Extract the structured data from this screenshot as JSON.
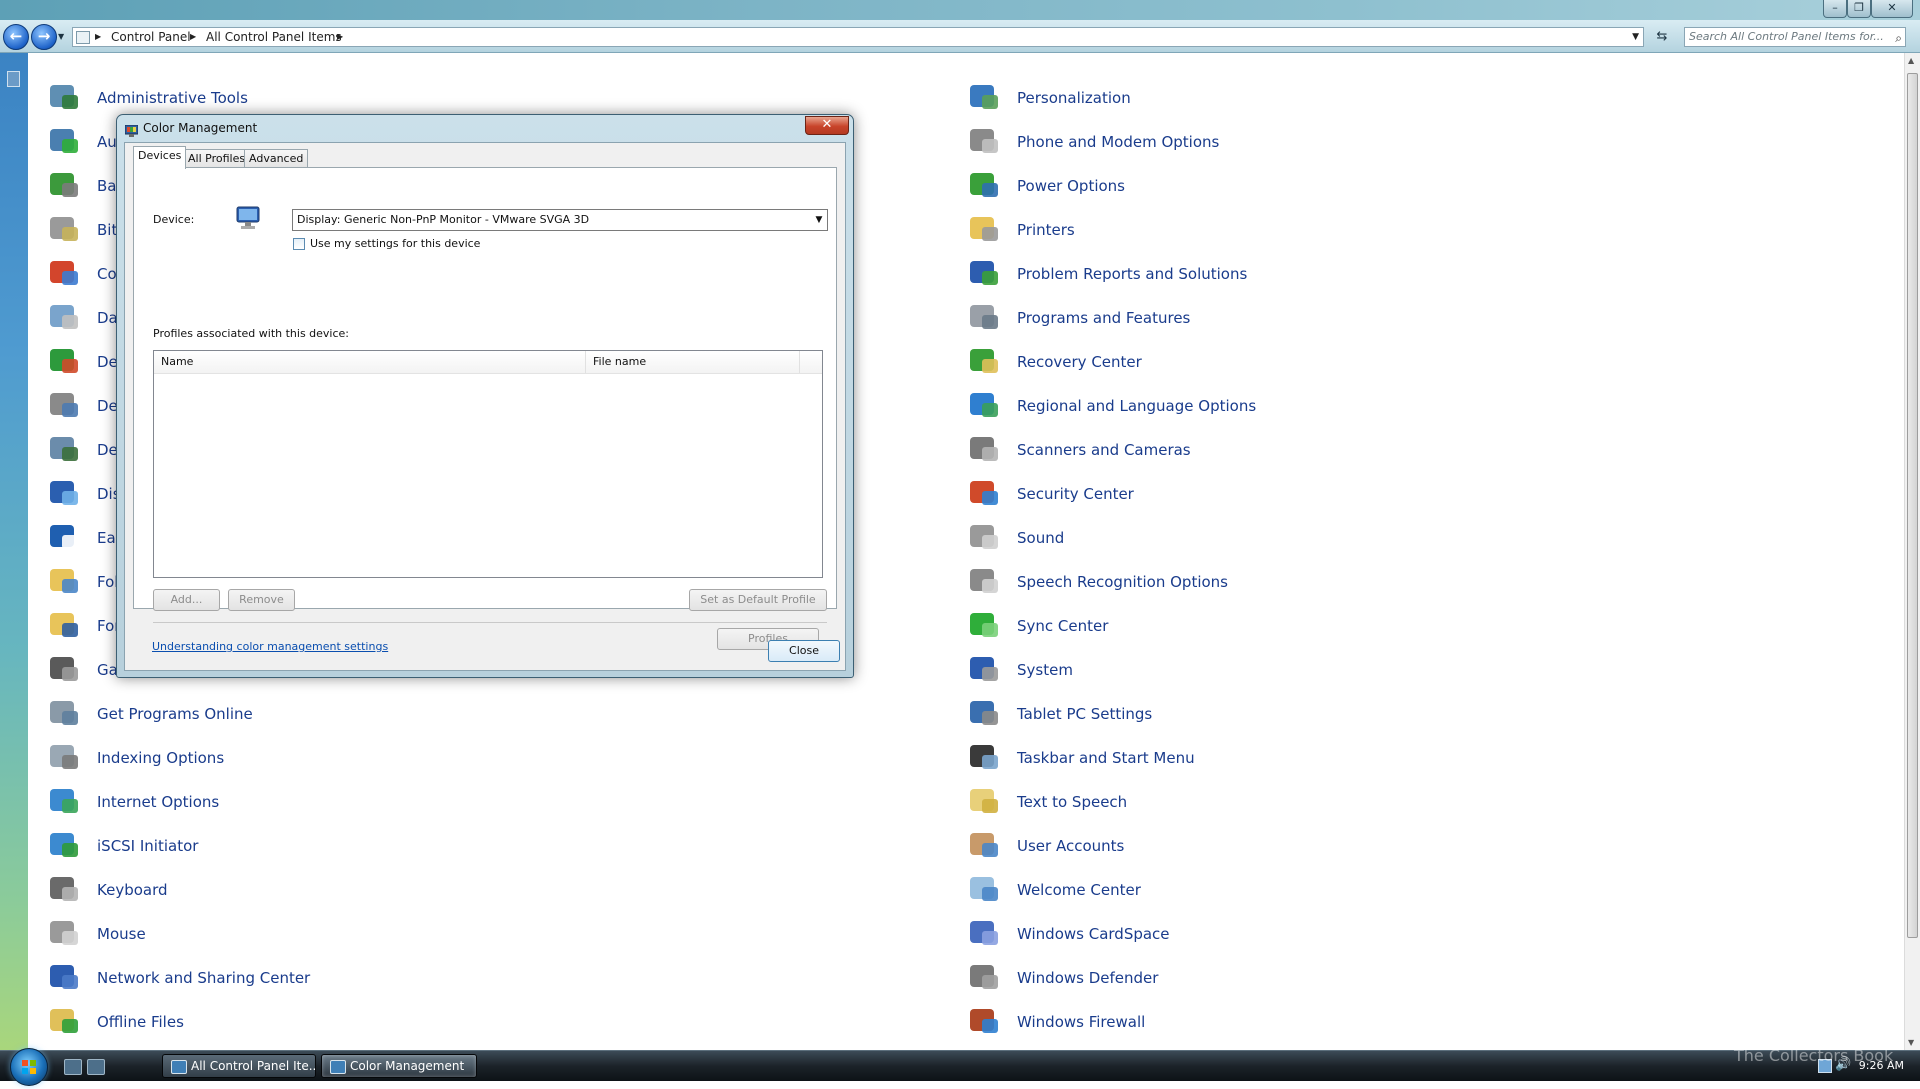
{
  "explorer": {
    "breadcrumb": [
      "Control Panel",
      "All Control Panel Items"
    ],
    "search_placeholder": "Search All Control Panel Items for...",
    "left_items": [
      {
        "label": "Administrative Tools",
        "icon": "administrative-tools-icon",
        "c1": "#5f8fb3",
        "c2": "#2f7a3a"
      },
      {
        "label": "AutoPlay",
        "icon": "autoplay-icon",
        "c1": "#4a7fb0",
        "c2": "#2fae3a"
      },
      {
        "label": "Backup and Restore Center",
        "icon": "backup-icon",
        "c1": "#3c9a3c",
        "c2": "#7b7b7b"
      },
      {
        "label": "BitLocker Drive Encryption",
        "icon": "bitlocker-icon",
        "c1": "#9a9a9a",
        "c2": "#c7b35a"
      },
      {
        "label": "Color Management",
        "icon": "color-management-icon",
        "c1": "#d3452c",
        "c2": "#3c7bd0"
      },
      {
        "label": "Date and Time",
        "icon": "date-time-icon",
        "c1": "#7aa4cc",
        "c2": "#c0c0c0"
      },
      {
        "label": "Default Programs",
        "icon": "default-programs-icon",
        "c1": "#2d9a3c",
        "c2": "#d04a2a"
      },
      {
        "label": "Device Manager",
        "icon": "device-icon",
        "c1": "#8a8a8a",
        "c2": "#4c7ab0"
      },
      {
        "label": "Device Manager",
        "icon": "device-manager-icon",
        "c1": "#6b8cab",
        "c2": "#3b6f3b"
      },
      {
        "label": "Display",
        "icon": "display-icon",
        "c1": "#2b5fb0",
        "c2": "#6fb0e8"
      },
      {
        "label": "Ease of Access Center",
        "icon": "ease-of-access-icon",
        "c1": "#1f5fb0",
        "c2": "#ffffff"
      },
      {
        "label": "Folder Options",
        "icon": "folder-options-icon",
        "c1": "#e8c45a",
        "c2": "#4a86c8"
      },
      {
        "label": "Fonts",
        "icon": "fonts-icon",
        "c1": "#e8c45a",
        "c2": "#2f5fa0"
      },
      {
        "label": "Game Controllers",
        "icon": "game-controllers-icon",
        "c1": "#5a5a5a",
        "c2": "#9a9a9a"
      },
      {
        "label": "Get Programs Online",
        "icon": "get-programs-icon",
        "c1": "#8a9aa8",
        "c2": "#5e7f9d"
      },
      {
        "label": "Indexing Options",
        "icon": "indexing-options-icon",
        "c1": "#9aa8b4",
        "c2": "#7a7a7a"
      },
      {
        "label": "Internet Options",
        "icon": "internet-options-icon",
        "c1": "#3c8ad0",
        "c2": "#3aa55a"
      },
      {
        "label": "iSCSI Initiator",
        "icon": "iscsi-initiator-icon",
        "c1": "#3c8ad0",
        "c2": "#2e9a3a"
      },
      {
        "label": "Keyboard",
        "icon": "keyboard-icon",
        "c1": "#6a6a6a",
        "c2": "#b4b4b4"
      },
      {
        "label": "Mouse",
        "icon": "mouse-icon",
        "c1": "#9a9a9a",
        "c2": "#d2d2d2"
      },
      {
        "label": "Network and Sharing Center",
        "icon": "network-sharing-icon",
        "c1": "#2d5db0",
        "c2": "#4a7ac8"
      },
      {
        "label": "Offline Files",
        "icon": "offline-files-icon",
        "c1": "#e0c05a",
        "c2": "#2fa03a"
      }
    ],
    "right_items": [
      {
        "label": "Personalization",
        "icon": "personalization-icon",
        "c1": "#3a7ac0",
        "c2": "#5aa05a"
      },
      {
        "label": "Phone and Modem Options",
        "icon": "phone-modem-icon",
        "c1": "#8a8a8a",
        "c2": "#c0c0c0"
      },
      {
        "label": "Power Options",
        "icon": "power-options-icon",
        "c1": "#3aa03a",
        "c2": "#2f6fb0"
      },
      {
        "label": "Printers",
        "icon": "printers-icon",
        "c1": "#e8c45a",
        "c2": "#9a9a9a"
      },
      {
        "label": "Problem Reports and Solutions",
        "icon": "problem-reports-icon",
        "c1": "#2d5db0",
        "c2": "#3aa03a"
      },
      {
        "label": "Programs and Features",
        "icon": "programs-features-icon",
        "c1": "#9aa0a8",
        "c2": "#6a7a88"
      },
      {
        "label": "Recovery Center",
        "icon": "recovery-center-icon",
        "c1": "#3aa03a",
        "c2": "#e0c05a"
      },
      {
        "label": "Regional and Language Options",
        "icon": "regional-language-icon",
        "c1": "#2f7fd0",
        "c2": "#3aa05a"
      },
      {
        "label": "Scanners and Cameras",
        "icon": "scanners-cameras-icon",
        "c1": "#7a7a7a",
        "c2": "#b4b4b4"
      },
      {
        "label": "Security Center",
        "icon": "security-center-icon",
        "c1": "#d04a2a",
        "c2": "#2f7fd0"
      },
      {
        "label": "Sound",
        "icon": "sound-icon",
        "c1": "#9a9a9a",
        "c2": "#cfcfcf"
      },
      {
        "label": "Speech Recognition Options",
        "icon": "speech-recognition-icon",
        "c1": "#8a8a8a",
        "c2": "#d0d0d0"
      },
      {
        "label": "Sync Center",
        "icon": "sync-center-icon",
        "c1": "#2fae3a",
        "c2": "#7ad07a"
      },
      {
        "label": "System",
        "icon": "system-icon",
        "c1": "#2d5db0",
        "c2": "#9a9a9a"
      },
      {
        "label": "Tablet PC Settings",
        "icon": "tablet-pc-icon",
        "c1": "#3a6fb0",
        "c2": "#8a8a8a"
      },
      {
        "label": "Taskbar and Start Menu",
        "icon": "taskbar-start-icon",
        "c1": "#3a3a3a",
        "c2": "#7aa4cc"
      },
      {
        "label": "Text to Speech",
        "icon": "text-to-speech-icon",
        "c1": "#e8d07a",
        "c2": "#d0b040"
      },
      {
        "label": "User Accounts",
        "icon": "user-accounts-icon",
        "c1": "#c89a6a",
        "c2": "#4a86c8"
      },
      {
        "label": "Welcome Center",
        "icon": "welcome-center-icon",
        "c1": "#9ac0e0",
        "c2": "#4a86c8"
      },
      {
        "label": "Windows CardSpace",
        "icon": "windows-cardspace-icon",
        "c1": "#4a6fc0",
        "c2": "#8aa0e0"
      },
      {
        "label": "Windows Defender",
        "icon": "windows-defender-icon",
        "c1": "#7a7a7a",
        "c2": "#a0a0a0"
      },
      {
        "label": "Windows Firewall",
        "icon": "windows-firewall-icon",
        "c1": "#b04a2a",
        "c2": "#2f7fd0"
      }
    ]
  },
  "dialog": {
    "title": "Color Management",
    "tabs": [
      "Devices",
      "All Profiles",
      "Advanced"
    ],
    "device_label": "Device:",
    "device_value": "Display: Generic Non-PnP Monitor - VMware SVGA 3D",
    "use_my_settings": "Use my settings for this device",
    "profiles_label": "Profiles associated with this device:",
    "columns": [
      "Name",
      "File name"
    ],
    "buttons": {
      "add": "Add...",
      "remove": "Remove",
      "set_default": "Set as Default Profile",
      "profiles": "Profiles",
      "close": "Close"
    },
    "link": "Understanding color management settings"
  },
  "taskbar": {
    "buttons": [
      "All Control Panel Ite...",
      "Color Management"
    ],
    "clock": "9:26 AM"
  },
  "watermark": "The Collectors Book"
}
